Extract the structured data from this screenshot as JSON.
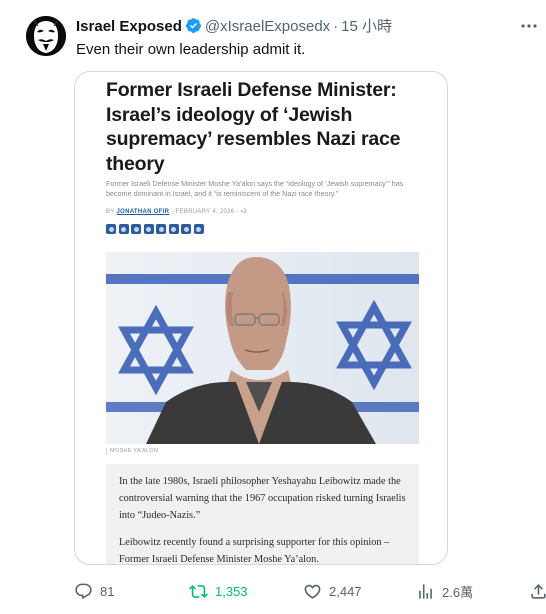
{
  "author": {
    "name": "Israel Exposed",
    "handle": "@xIsraelExposedx",
    "separator": "·",
    "time": "15 小時",
    "verified_color": "#1d9bf0"
  },
  "tweet": {
    "text": "Even their own leadership admit it."
  },
  "article": {
    "headline": "Former Israeli Defense Minister: Israel’s ideology of ‘Jewish supremacy’ resembles Nazi race theory",
    "subheadline": "Former Israeli Defense Minister Moshe Ya’alon says the “ideology of ‘Jewish supremacy’” has become dominant in Israel, and it “is reminiscent of the Nazi race theory.”",
    "byline_prefix": "BY",
    "author": "JONATHAN OFIR",
    "date": "· FEBRUARY 4, 2026 ·",
    "comment_count": "3",
    "share_icons": [
      "facebook-icon",
      "x-icon",
      "whatsapp-icon",
      "linkedin-icon",
      "reddit-icon",
      "telegram-icon",
      "email-icon",
      "print-icon"
    ],
    "photo_caption": "MOSHE YA’ALON",
    "paragraph_1": "In the late 1980s, Israeli philosopher Yeshayahu Leibowitz made the controversial warning that the 1967 occupation risked turning Israelis into “Judeo-Nazis.”",
    "paragraph_2": "Leibowitz recently found a surprising supporter for this opinion – Former Israeli Defense Minister Moshe Ya’alon."
  },
  "actions": {
    "replies": "81",
    "reposts": "1,353",
    "likes": "2,447",
    "views": "2.6萬"
  },
  "colors": {
    "text": "#0f1419",
    "muted": "#536471",
    "repost_green": "#00ba7c",
    "border": "#cfd9de",
    "flag_blue": "#1f4fb0"
  }
}
